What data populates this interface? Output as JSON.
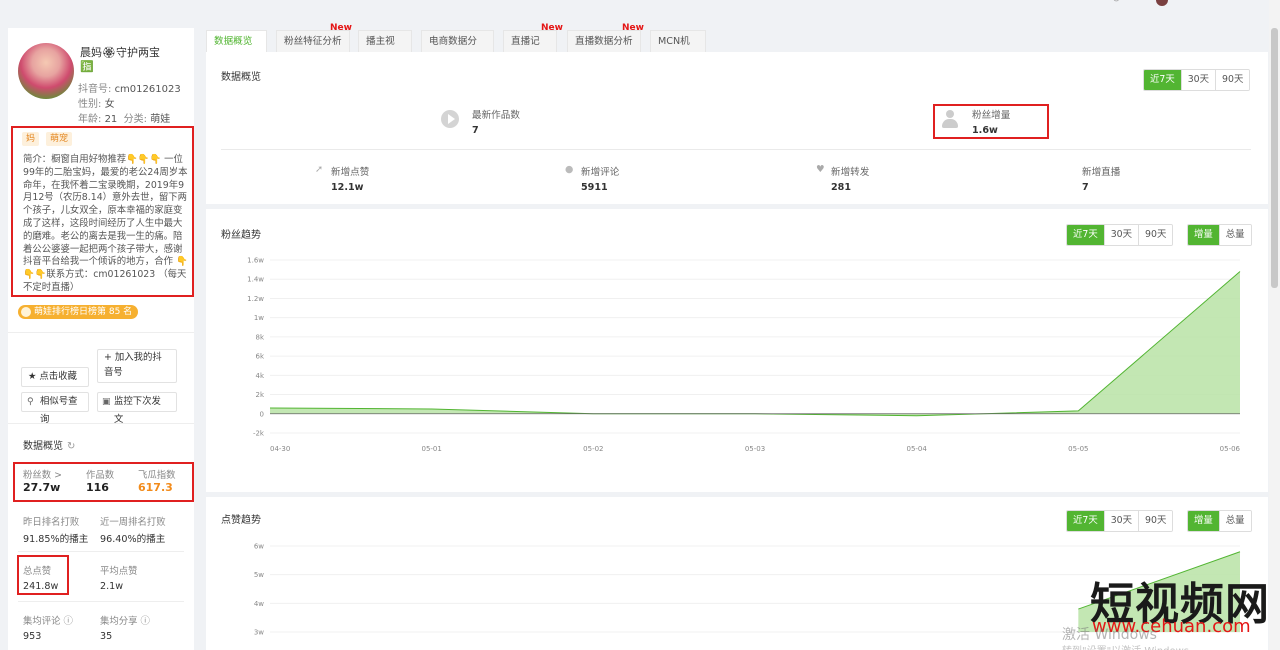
{
  "profile": {
    "name": "晨妈🏵守护两宝 🈯",
    "douyin_id_label": "抖音号:",
    "douyin_id": "cm01261023",
    "gender_label": "性别:",
    "gender": "女",
    "age_label": "年龄:",
    "age": "21",
    "category_label": "分类:",
    "category": "萌娃",
    "tags": [
      "妈",
      "萌宠"
    ],
    "bio": "简介：橱窗自用好物推荐👇👇👇 一位99年的二胎宝妈，最爱的老公24周岁本命年，在我怀着二宝录晚期，2019年9月12号（农历8.14）意外去世，留下两个孩子，儿女双全，原本幸福的家庭变成了这样，这段时间经历了人生中最大的磨难。老公的离去是我一生的痛。陪着公公婆婆一起把两个孩子带大，感谢抖音平台给我一个倾诉的地方，合作 👇👇👇联系方式：cm01261023 （每天不定时直播）",
    "rank_badge": "萌娃排行榜日榜第 85 名",
    "btn_add": "+ 加入我的抖音号",
    "btn_fav": "★ 点击收藏",
    "btn_similar": "相似号查询",
    "btn_monitor": "监控下次发文"
  },
  "overview": {
    "title": "数据概览",
    "fans_label": "粉丝数 >",
    "fans": "27.7w",
    "works_label": "作品数",
    "works": "116",
    "index_label": "飞瓜指数",
    "index": "617.3",
    "rank_yesterday_label": "昨日排名打败",
    "rank_yesterday": "91.85%的播主",
    "rank_week_label": "近一周排名打败",
    "rank_week": "96.40%的播主",
    "likes_total_label": "总点赞",
    "likes_total": "241.8w",
    "likes_avg_label": "平均点赞",
    "likes_avg": "2.1w",
    "comments_avg_label": "集均评论",
    "comments_avg": "953",
    "shares_avg_label": "集均分享",
    "shares_avg": "35"
  },
  "tabs": [
    {
      "label": "数据概览",
      "new": ""
    },
    {
      "label": "粉丝特征分析",
      "new": "New"
    },
    {
      "label": "播主视频",
      "new": ""
    },
    {
      "label": "电商数据分析",
      "new": ""
    },
    {
      "label": "直播记录",
      "new": "New"
    },
    {
      "label": "直播数据分析",
      "new": "New"
    },
    {
      "label": "MCN机构",
      "new": ""
    }
  ],
  "summary": {
    "title": "数据概览",
    "ranges": [
      "近7天",
      "30天",
      "90天"
    ],
    "latest_works_label": "最新作品数",
    "latest_works": "7",
    "fans_growth_label": "粉丝增量",
    "fans_growth": "1.6w",
    "new_likes_label": "新增点赞",
    "new_likes": "12.1w",
    "new_comments_label": "新增评论",
    "new_comments": "5911",
    "new_shares_label": "新增转发",
    "new_shares": "281",
    "new_live_label": "新增直播",
    "new_live": "7"
  },
  "fans_trend": {
    "title": "粉丝趋势",
    "ranges": [
      "近7天",
      "30天",
      "90天"
    ],
    "modes": [
      "增量",
      "总量"
    ]
  },
  "likes_trend": {
    "title": "点赞趋势",
    "ranges": [
      "近7天",
      "30天",
      "90天"
    ],
    "modes": [
      "增量",
      "总量"
    ]
  },
  "chart_data": [
    {
      "type": "area",
      "title": "粉丝趋势",
      "x": [
        "04-30",
        "05-01",
        "05-02",
        "05-03",
        "05-04",
        "05-05",
        "05-06"
      ],
      "y_ticks": [
        "1.6w",
        "1.4w",
        "1.2w",
        "1w",
        "8k",
        "6k",
        "4k",
        "2k",
        "0",
        "-2k"
      ],
      "ylim": [
        -2000,
        16000
      ],
      "series": [
        {
          "values": [
            600,
            500,
            0,
            0,
            -200,
            300,
            14800
          ]
        }
      ],
      "color": "#52b532"
    },
    {
      "type": "area",
      "title": "点赞趋势",
      "y_ticks": [
        "6w",
        "5w",
        "4w",
        "3w"
      ],
      "ylim": [
        30000,
        60000
      ],
      "series": [
        {
          "values": [
            null,
            null,
            null,
            null,
            null,
            38000,
            58000
          ]
        }
      ],
      "color": "#52b532"
    }
  ],
  "watermark": {
    "brand": "短视频网",
    "url": "www.cehuan.com",
    "activate": "激活 Windows",
    "activate_sub": "转到\"设置\"以激活 Windows。"
  },
  "colors": {
    "accent": "#52b532",
    "highlight": "#e02020",
    "orange": "#f28b1b"
  }
}
